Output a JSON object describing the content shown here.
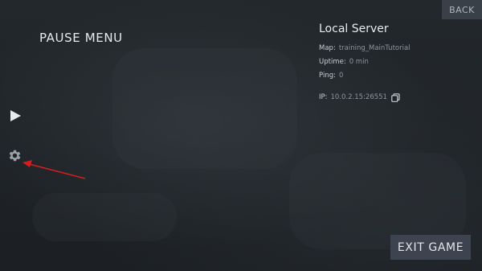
{
  "header": {
    "back_label": "BACK"
  },
  "menu": {
    "title": "PAUSE MENU"
  },
  "server": {
    "name": "Local Server",
    "map_label": "Map:",
    "map_value": "training_MainTutorial",
    "uptime_label": "Uptime:",
    "uptime_value": "0 min",
    "ping_label": "Ping:",
    "ping_value": "0",
    "ip_label": "IP:",
    "ip_value": "10.0.2.15:26551"
  },
  "footer": {
    "exit_label": "EXIT GAME"
  },
  "icons": {
    "resume": "play-icon",
    "settings": "gear-icon",
    "copy": "copy-icon"
  },
  "colors": {
    "background": "#1f2327",
    "button_bg": "#3d4450",
    "annotation_arrow": "#d11f1f"
  }
}
